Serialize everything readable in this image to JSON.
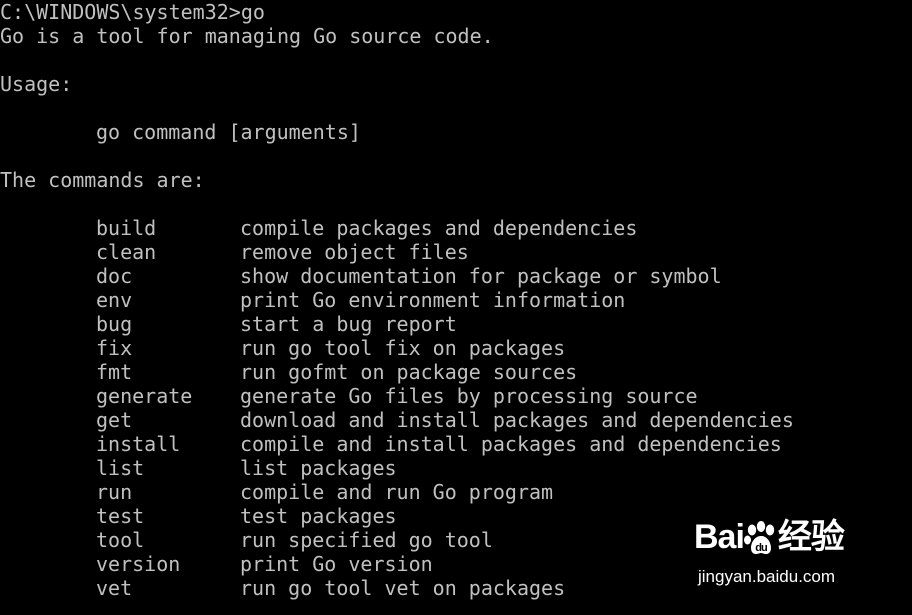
{
  "terminal": {
    "prompt": "C:\\WINDOWS\\system32>go",
    "intro": "Go is a tool for managing Go source code.",
    "usage_label": "Usage:",
    "usage_command": "go command [arguments]",
    "commands_label": "The commands are:",
    "commands": [
      {
        "name": "build",
        "desc": "compile packages and dependencies"
      },
      {
        "name": "clean",
        "desc": "remove object files"
      },
      {
        "name": "doc",
        "desc": "show documentation for package or symbol"
      },
      {
        "name": "env",
        "desc": "print Go environment information"
      },
      {
        "name": "bug",
        "desc": "start a bug report"
      },
      {
        "name": "fix",
        "desc": "run go tool fix on packages"
      },
      {
        "name": "fmt",
        "desc": "run gofmt on package sources"
      },
      {
        "name": "generate",
        "desc": "generate Go files by processing source"
      },
      {
        "name": "get",
        "desc": "download and install packages and dependencies"
      },
      {
        "name": "install",
        "desc": "compile and install packages and dependencies"
      },
      {
        "name": "list",
        "desc": "list packages"
      },
      {
        "name": "run",
        "desc": "compile and run Go program"
      },
      {
        "name": "test",
        "desc": "test packages"
      },
      {
        "name": "tool",
        "desc": "run specified go tool"
      },
      {
        "name": "version",
        "desc": "print Go version"
      },
      {
        "name": "vet",
        "desc": "run go tool vet on packages"
      }
    ]
  },
  "watermark": {
    "brand_left": "Bai",
    "brand_right": "经验",
    "url": "jingyan.baidu.com"
  },
  "colors": {
    "background": "#000000",
    "text": "#c0c0c0"
  }
}
